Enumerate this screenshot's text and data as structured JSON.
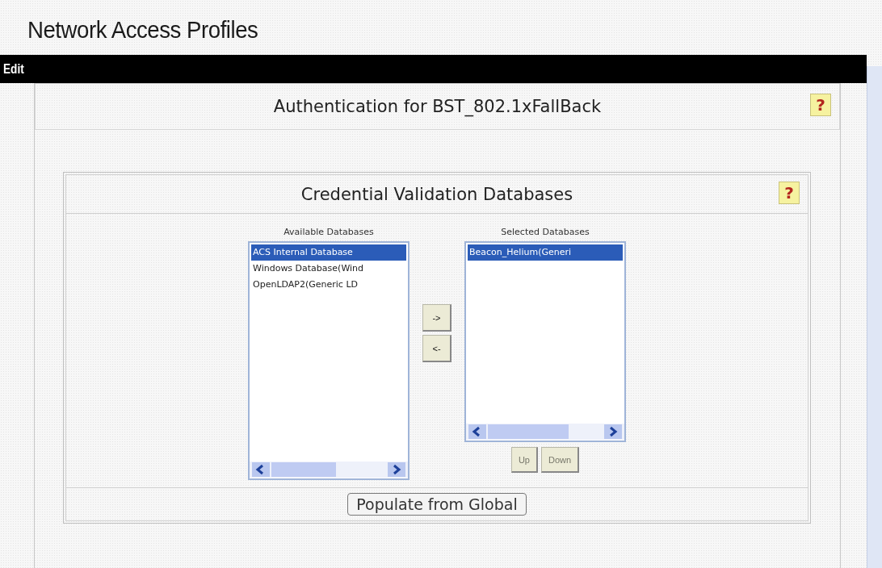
{
  "page_title": "Network Access Profiles",
  "menu_bar": {
    "label": "Edit"
  },
  "panel": {
    "title": "Authentication for BST_802.1xFallBack",
    "help": "?",
    "section": {
      "title": "Credential Validation Databases",
      "help": "?",
      "available": {
        "label": "Available Databases",
        "items": [
          {
            "text": "ACS Internal Database",
            "selected": true
          },
          {
            "text": "Windows Database(Wind",
            "selected": false
          },
          {
            "text": "OpenLDAP2(Generic LD",
            "selected": false
          }
        ]
      },
      "move_buttons": [
        {
          "label": "->",
          "disabled": false
        },
        {
          "label": "<-",
          "disabled": false
        }
      ],
      "selected": {
        "label": "Selected Databases",
        "items": [
          {
            "text": "Beacon_Helium(Generi",
            "selected": true
          }
        ]
      },
      "order_buttons": [
        {
          "label": "Up",
          "disabled": true
        },
        {
          "label": "Down",
          "disabled": true
        }
      ]
    },
    "populate_button": "Populate from Global"
  }
}
